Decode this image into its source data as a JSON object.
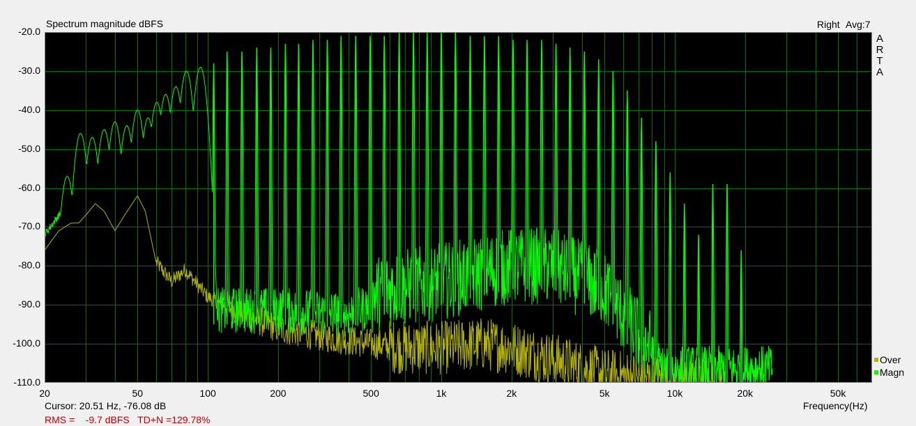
{
  "chart_data": {
    "type": "line",
    "title": "Spectrum magnitude dBFS",
    "channel": "Right",
    "averaging": "Avg:7",
    "brand": [
      "A",
      "R",
      "T",
      "A"
    ],
    "xlabel": "Frequency(Hz)",
    "x_scale": "log",
    "xlim": [
      20,
      70000
    ],
    "ylim": [
      -110,
      -20
    ],
    "y_ticks": [
      {
        "value": -20,
        "label": "-20.0"
      },
      {
        "value": -30,
        "label": "-30.0"
      },
      {
        "value": -40,
        "label": "-40.0"
      },
      {
        "value": -50,
        "label": "-50.0"
      },
      {
        "value": -60,
        "label": "-60.0"
      },
      {
        "value": -70,
        "label": "-70.0"
      },
      {
        "value": -80,
        "label": "-80.0"
      },
      {
        "value": -90,
        "label": "-90.0"
      },
      {
        "value": -100,
        "label": "-100.0"
      },
      {
        "value": -110,
        "label": "-110.0"
      }
    ],
    "x_ticks": [
      {
        "value": 20,
        "label": "20"
      },
      {
        "value": 50,
        "label": "50"
      },
      {
        "value": 100,
        "label": "100"
      },
      {
        "value": 200,
        "label": "200"
      },
      {
        "value": 500,
        "label": "500"
      },
      {
        "value": 1000,
        "label": "1k"
      },
      {
        "value": 2000,
        "label": "2k"
      },
      {
        "value": 5000,
        "label": "5k"
      },
      {
        "value": 10000,
        "label": "10k"
      },
      {
        "value": 20000,
        "label": "20k"
      },
      {
        "value": 50000,
        "label": "50k"
      }
    ],
    "grid_freqs": [
      20,
      30,
      40,
      50,
      60,
      70,
      80,
      90,
      100,
      200,
      300,
      400,
      500,
      600,
      700,
      800,
      900,
      1000,
      2000,
      3000,
      4000,
      5000,
      6000,
      7000,
      8000,
      9000,
      10000,
      20000,
      30000,
      40000,
      50000,
      60000,
      70000
    ],
    "grid": true,
    "legend_position": "bottom-right",
    "colors": {
      "Magn": "#00ff00",
      "Over": "#b4b400",
      "background": "#000000",
      "grid": "#007000"
    },
    "series": [
      {
        "name": "Magn",
        "harmonic_peaks": [
          {
            "f": 20,
            "db": -74
          },
          {
            "f": 25,
            "db": -57
          },
          {
            "f": 28.5,
            "db": -46
          },
          {
            "f": 32,
            "db": -47
          },
          {
            "f": 36,
            "db": -45
          },
          {
            "f": 40,
            "db": -43
          },
          {
            "f": 45,
            "db": -44
          },
          {
            "f": 50,
            "db": -40
          },
          {
            "f": 55.5,
            "db": -42
          },
          {
            "f": 60.5,
            "db": -38
          },
          {
            "f": 66,
            "db": -36
          },
          {
            "f": 73,
            "db": -34
          },
          {
            "f": 81,
            "db": -30
          },
          {
            "f": 93,
            "db": -29
          },
          {
            "f": 106,
            "db": -28
          },
          {
            "f": 121,
            "db": -25
          },
          {
            "f": 140,
            "db": -25
          },
          {
            "f": 162,
            "db": -24
          },
          {
            "f": 186,
            "db": -24
          },
          {
            "f": 215,
            "db": -23
          },
          {
            "f": 245,
            "db": -23
          },
          {
            "f": 282,
            "db": -22
          },
          {
            "f": 325,
            "db": -22
          },
          {
            "f": 372,
            "db": -21
          },
          {
            "f": 430,
            "db": -21
          },
          {
            "f": 496,
            "db": -21
          },
          {
            "f": 570,
            "db": -21
          },
          {
            "f": 660,
            "db": -20
          },
          {
            "f": 760,
            "db": -20
          },
          {
            "f": 870,
            "db": -20
          },
          {
            "f": 1000,
            "db": -20
          },
          {
            "f": 1150,
            "db": -20
          },
          {
            "f": 1330,
            "db": -21
          },
          {
            "f": 1530,
            "db": -21
          },
          {
            "f": 1760,
            "db": -21
          },
          {
            "f": 2030,
            "db": -22
          },
          {
            "f": 2330,
            "db": -22
          },
          {
            "f": 2690,
            "db": -22
          },
          {
            "f": 3100,
            "db": -23
          },
          {
            "f": 3560,
            "db": -24
          },
          {
            "f": 4100,
            "db": -25
          },
          {
            "f": 4720,
            "db": -27
          },
          {
            "f": 5440,
            "db": -30
          },
          {
            "f": 6260,
            "db": -35
          },
          {
            "f": 7200,
            "db": -42
          },
          {
            "f": 8300,
            "db": -48
          },
          {
            "f": 9550,
            "db": -56
          },
          {
            "f": 11000,
            "db": -64
          },
          {
            "f": 12650,
            "db": -72
          },
          {
            "f": 14550,
            "db": -59
          },
          {
            "f": 16750,
            "db": -59
          },
          {
            "f": 19250,
            "db": -76
          }
        ],
        "noise_floor": [
          {
            "f": 100,
            "db": -95
          },
          {
            "f": 200,
            "db": -95
          },
          {
            "f": 400,
            "db": -96
          },
          {
            "f": 600,
            "db": -92
          },
          {
            "f": 1000,
            "db": -90
          },
          {
            "f": 2000,
            "db": -86
          },
          {
            "f": 3000,
            "db": -86
          },
          {
            "f": 5000,
            "db": -92
          },
          {
            "f": 7000,
            "db": -104
          },
          {
            "f": 9000,
            "db": -110
          }
        ]
      },
      {
        "name": "Over",
        "points": [
          {
            "f": 20,
            "db": -76
          },
          {
            "f": 23,
            "db": -71
          },
          {
            "f": 26,
            "db": -69
          },
          {
            "f": 28,
            "db": -69
          },
          {
            "f": 30,
            "db": -67
          },
          {
            "f": 33,
            "db": -64
          },
          {
            "f": 36,
            "db": -66
          },
          {
            "f": 40,
            "db": -71
          },
          {
            "f": 44,
            "db": -67
          },
          {
            "f": 50,
            "db": -62
          },
          {
            "f": 54,
            "db": -66
          },
          {
            "f": 60,
            "db": -79
          },
          {
            "f": 70,
            "db": -84
          },
          {
            "f": 80,
            "db": -81
          },
          {
            "f": 100,
            "db": -88
          },
          {
            "f": 150,
            "db": -93
          },
          {
            "f": 200,
            "db": -96
          },
          {
            "f": 300,
            "db": -98
          },
          {
            "f": 500,
            "db": -100
          },
          {
            "f": 700,
            "db": -101
          },
          {
            "f": 1000,
            "db": -101
          },
          {
            "f": 1500,
            "db": -100
          },
          {
            "f": 2000,
            "db": -101
          },
          {
            "f": 3000,
            "db": -104
          },
          {
            "f": 5000,
            "db": -108
          },
          {
            "f": 10000,
            "db": -110
          },
          {
            "f": 20000,
            "db": -110
          }
        ]
      }
    ],
    "legend": [
      {
        "name": "Over",
        "color": "#b4b400"
      },
      {
        "name": "Magn",
        "color": "#00ff00"
      }
    ]
  },
  "cursor_text": "Cursor: 20.51 Hz, -76.08 dB",
  "rms_text": "RMS =    -9.7 dBFS   TD+N =129.78%"
}
